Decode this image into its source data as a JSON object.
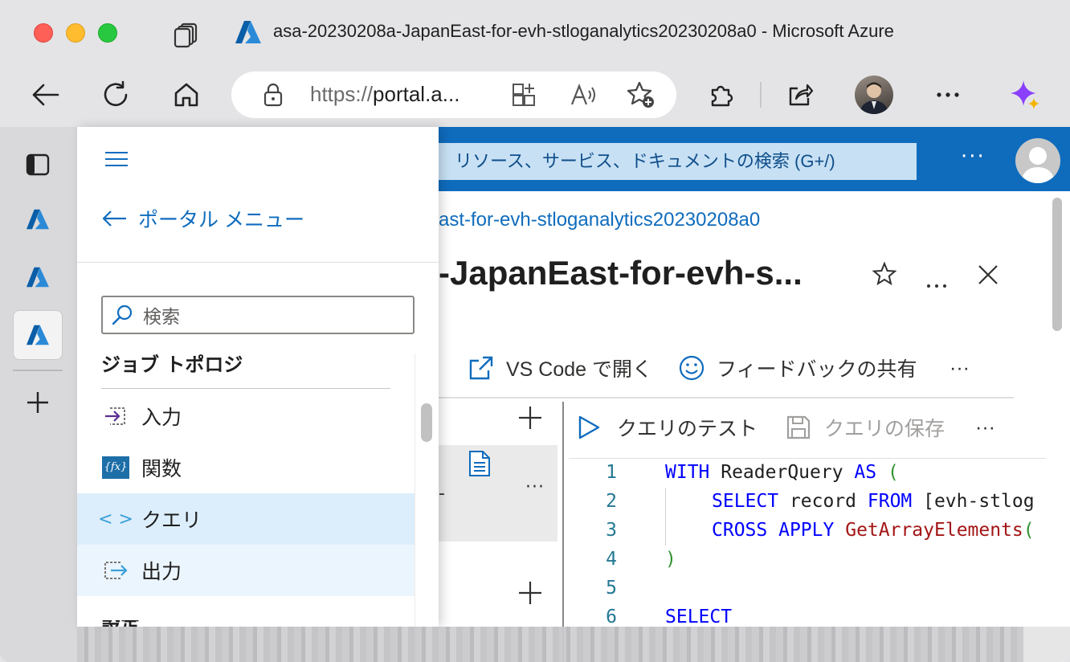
{
  "window": {
    "title": "asa-20230208a-JapanEast-for-evh-stloganalytics20230208a0 - Microsoft Azure"
  },
  "address_bar": {
    "scheme": "https://",
    "host": "portal.a..."
  },
  "azure": {
    "search_placeholder": "リソース、サービス、ドキュメントの検索 (G+/)",
    "more": "···",
    "breadcrumb": "ast-for-evh-stloganalytics20230208a0",
    "page_title": "-JapanEast-for-evh-s...",
    "commands": {
      "chevron": "∨",
      "vscode": "VS Code で開く",
      "feedback": "フィードバックの共有",
      "more": "···"
    },
    "query_bar": {
      "test": "クエリのテスト",
      "save": "クエリの保存",
      "more": "···"
    },
    "left_pane": {
      "more": "···",
      "dash": "-"
    }
  },
  "editor": {
    "lines": [
      {
        "n": "1"
      },
      {
        "n": "2"
      },
      {
        "n": "3"
      },
      {
        "n": "4"
      },
      {
        "n": "5"
      },
      {
        "n": "6"
      }
    ],
    "tokens": {
      "with": "WITH",
      "readerquery": " ReaderQuery ",
      "as": "AS",
      "paren_open": " (",
      "select": "SELECT",
      "record": " record ",
      "from": "FROM",
      "source": " [evh-stlog",
      "cross": "CROSS",
      "apply": "APPLY",
      "getarray": "GetArrayElements",
      "paren2": "(",
      "close": ")",
      "select2": "SELECT"
    }
  },
  "menu": {
    "back_label": "ポータル メニュー",
    "search_placeholder": "検索",
    "section": "ジョブ トポロジ",
    "items": [
      {
        "label": "入力",
        "icon": "input-icon"
      },
      {
        "label": "関数",
        "icon": "function-icon",
        "icon_text": "{fx}"
      },
      {
        "label": "クエリ",
        "icon": "code-icon",
        "icon_text": "< >"
      },
      {
        "label": "出力",
        "icon": "output-icon"
      }
    ],
    "next_section_cut": "設定"
  },
  "colors": {
    "azure_blue": "#0f6cbd",
    "selection": "#dceefb"
  }
}
